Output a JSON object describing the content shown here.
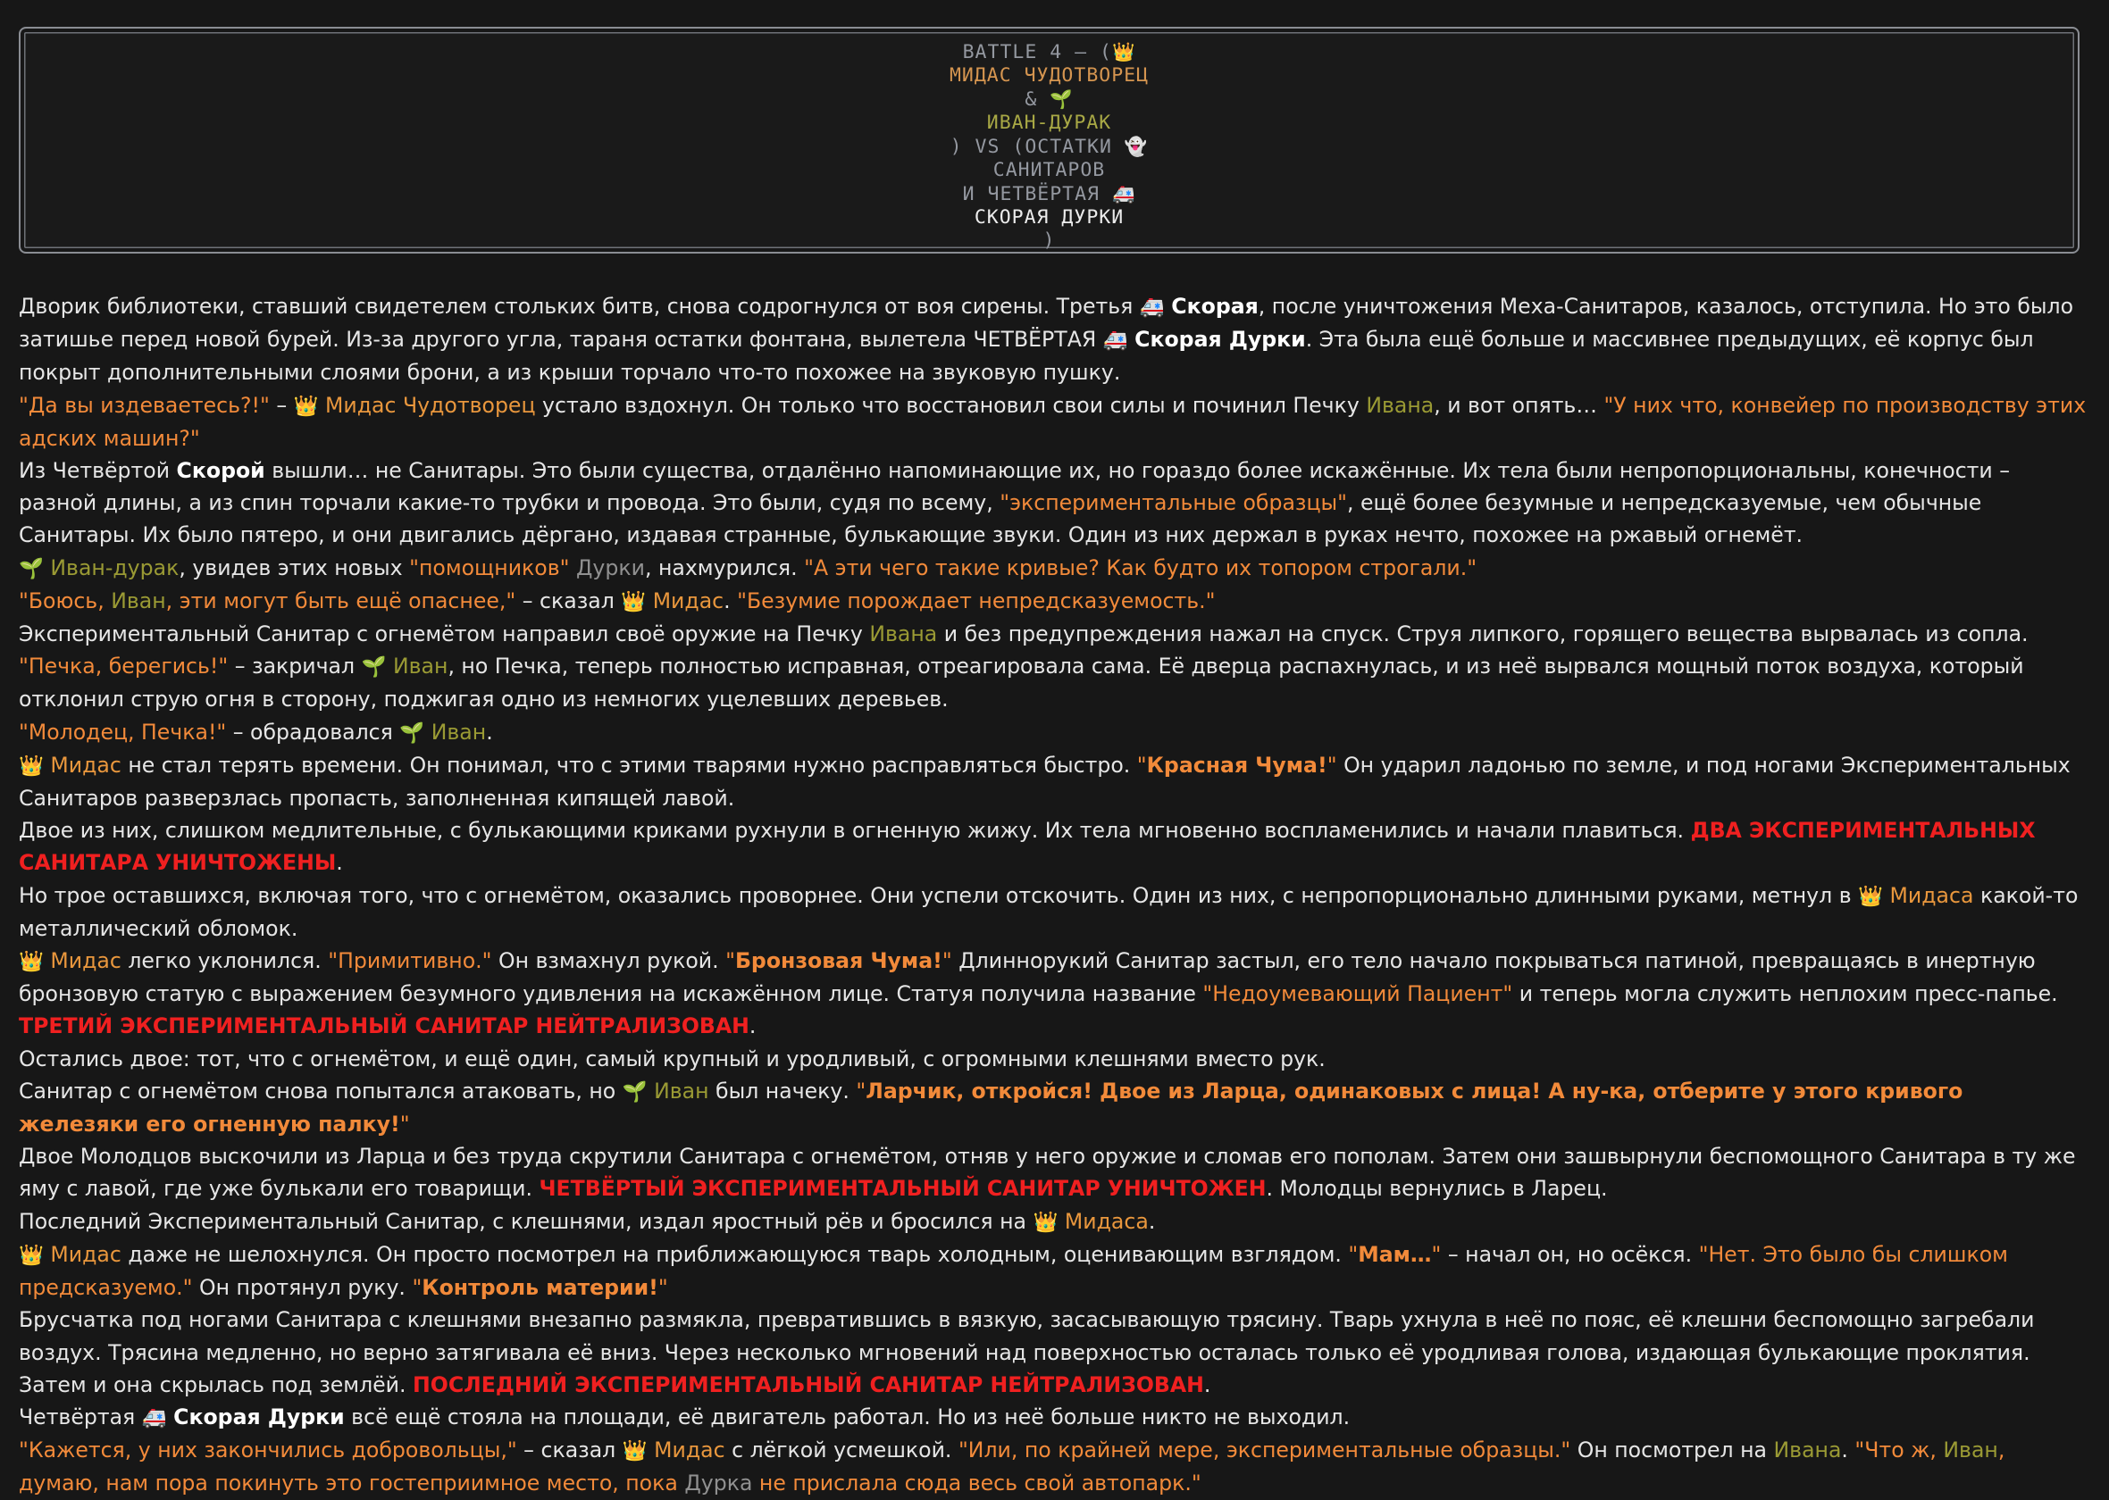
{
  "banner": {
    "l1": "BATTLE 4 – (",
    "l1_icon": "👑",
    "l2": "МИДАС ЧУДОТВОРЕЦ",
    "l3": "&",
    "l3_icon": "🌱",
    "l4": "ИВАН-ДУРАК",
    "l5": ") VS (ОСТАТКИ",
    "l5_icon": "👻",
    "l6": "САНИТАРОВ",
    "l7": "И ЧЕТВЁРТАЯ",
    "l7_icon": "🚑",
    "l8": "СКОРАЯ ДУРКИ",
    "l9": ")"
  },
  "icons": {
    "crown": "👑",
    "sprout": "🌱",
    "ambulance": "🚑"
  },
  "colors": {
    "background": "#171717",
    "quote": "#f28a3a",
    "ivan": "#9a9a34",
    "status": "#f02020",
    "durka": "#909090"
  },
  "story": {
    "p1": {
      "a": "Дворик библиотеки, ставший свидетелем стольких битв, снова содрогнулся от воя сирены. Третья ",
      "b": "Скорая",
      "c": ", после уничтожения Меха-Санитаров, казалось, отступила. Но это было затишье перед новой бурей. Из-за другого угла, тараня остатки фонтана, вылетела ЧЕТВЁРТАЯ ",
      "d": "Скорая Дурки",
      "e": ". Эта была ещё больше и массивнее предыдущих, её корпус был покрыт дополнительными слоями брони, а из крыши торчало что-то похожее на звуковую пушку."
    },
    "p2": {
      "a": "\"Да вы издеваетесь?!\"",
      "b": " – ",
      "c": "Мидас Чудотворец",
      "d": " устало вздохнул. Он только что восстановил свои силы и починил Печку ",
      "e": "Ивана",
      "f": ", и вот опять… ",
      "g": "\"У них что, конвейер по производству этих адских машин?\""
    },
    "p3": {
      "a": "Из Четвёртой ",
      "b": "Скорой",
      "c": " вышли… не Санитары. Это были существа, отдалённо напоминающие их, но гораздо более искажённые. Их тела были непропорциональны, конечности – разной длины, а из спин торчали какие-то трубки и провода. Это были, судя по всему, ",
      "d": "\"экспериментальные образцы\"",
      "e": ", ещё более безумные и непредсказуемые, чем обычные Санитары. Их было пятеро, и они двигались дёргано, издавая странные, булькающие звуки. Один из них держал в руках нечто, похожее на ржавый огнемёт."
    },
    "p4": {
      "a": "Иван-дурак",
      "b": ", увидев этих новых ",
      "c": "\"помощников\"",
      "d": " Дурки",
      "e": ", нахмурился. ",
      "f": "\"А эти чего такие кривые? Как будто их топором строгали.\""
    },
    "p5": {
      "a": "\"Боюсь, ",
      "b": "Иван",
      "c": ", эти могут быть ещё опаснее,\"",
      "d": " – сказал ",
      "e": "Мидас",
      "f": ". ",
      "g": "\"Безумие порождает непредсказуемость.\""
    },
    "p6": {
      "a": "Экспериментальный Санитар с огнемётом направил своё оружие на Печку ",
      "b": "Ивана",
      "c": " и без предупреждения нажал на спуск. Струя липкого, горящего вещества вырвалась из сопла."
    },
    "p7": {
      "a": "\"Печка, берегись!\"",
      "b": " – закричал ",
      "c": "Иван",
      "d": ", но Печка, теперь полностью исправная, отреагировала сама. Её дверца распахнулась, и из неё вырвался мощный поток воздуха, который отклонил струю огня в сторону, поджигая одно из немногих уцелевших деревьев."
    },
    "p8": {
      "a": "\"Молодец, Печка!\"",
      "b": " – обрадовался ",
      "c": "Иван",
      "d": "."
    },
    "p9": {
      "a": "Мидас",
      "b": " не стал терять времени. Он понимал, что с этими тварями нужно расправляться быстро. ",
      "c": "\"",
      "d": "Красная Чума!",
      "e": "\"",
      "f": " Он ударил ладонью по земле, и под ногами Экспериментальных Санитаров разверзлась пропасть, заполненная кипящей лавой."
    },
    "p10": {
      "a": "Двое из них, слишком медлительные, с булькающими криками рухнули в огненную жижу. Их тела мгновенно воспламенились и начали плавиться. ",
      "b": "ДВА ЭКСПЕРИМЕНТАЛЬНЫХ САНИТАРА УНИЧТОЖЕНЫ",
      "c": "."
    },
    "p11": {
      "a": "Но трое оставшихся, включая того, что с огнемётом, оказались проворнее. Они успели отскочить. Один из них, с непропорционально длинными руками, метнул в ",
      "b": "Мидаса",
      "c": " какой-то металлический обломок."
    },
    "p12": {
      "a": "Мидас",
      "b": " легко уклонился. ",
      "c": "\"Примитивно.\"",
      "d": " Он взмахнул рукой. ",
      "e": "\"",
      "f": "Бронзовая Чума!",
      "g": "\"",
      "h": " Длиннорукий Санитар застыл, его тело начало покрываться патиной, превращаясь в инертную бронзовую статую с выражением безумного удивления на искажённом лице. Статуя получила название ",
      "i": "\"Недоумевающий Пациент\"",
      "j": " и теперь могла служить неплохим пресс-папье. ",
      "k": "ТРЕТИЙ ЭКСПЕРИМЕНТАЛЬНЫЙ САНИТАР НЕЙТРАЛИЗОВАН",
      "l": "."
    },
    "p13": {
      "a": "Остались двое: тот, что с огнемётом, и ещё один, самый крупный и уродливый, с огромными клешнями вместо рук."
    },
    "p14": {
      "a": "Санитар с огнемётом снова попытался атаковать, но ",
      "b": "Иван",
      "c": " был начеку. ",
      "d": "\"",
      "e": "Ларчик, откройся! Двое из Ларца, одинаковых с лица! А ну-ка, отберите у этого кривого железяки его огненную палку!",
      "f": "\""
    },
    "p15": {
      "a": "Двое Молодцов выскочили из Ларца и без труда скрутили Санитара с огнемётом, отняв у него оружие и сломав его пополам. Затем они зашвырнули беспомощного Санитара в ту же яму с лавой, где уже булькали его товарищи. ",
      "b": "ЧЕТВЁРТЫЙ ЭКСПЕРИМЕНТАЛЬНЫЙ САНИТАР УНИЧТОЖЕН",
      "c": ". Молодцы вернулись в Ларец."
    },
    "p16": {
      "a": "Последний Экспериментальный Санитар, с клешнями, издал яростный рёв и бросился на ",
      "b": "Мидаса",
      "c": "."
    },
    "p17": {
      "a": "Мидас",
      "b": " даже не шелохнулся. Он просто посмотрел на приближающуюся тварь холодным, оценивающим взглядом. ",
      "c": "\"",
      "d": "Мам…",
      "e": "\"",
      "f": " – начал он, но осёкся. ",
      "g": "\"Нет. Это было бы слишком предсказуемо.\"",
      "h": " Он протянул руку. ",
      "i": "\"",
      "j": "Контроль материи!",
      "k": "\""
    },
    "p18": {
      "a": "Брусчатка под ногами Санитара с клешнями внезапно размякла, превратившись в вязкую, засасывающую трясину. Тварь ухнула в неё по пояс, её клешни беспомощно загребали воздух. Трясина медленно, но верно затягивала её вниз. Через несколько мгновений над поверхностью осталась только её уродливая голова, издающая булькающие проклятия. Затем и она скрылась под землёй. ",
      "b": "ПОСЛЕДНИЙ ЭКСПЕРИМЕНТАЛЬНЫЙ САНИТАР НЕЙТРАЛИЗОВАН",
      "c": "."
    },
    "p19": {
      "a": "Четвёртая ",
      "b": "Скорая Дурки",
      "c": " всё ещё стояла на площади, её двигатель работал. Но из неё больше никто не выходил."
    },
    "p20": {
      "a": "\"Кажется, у них закончились добровольцы,\"",
      "b": " – сказал ",
      "c": "Мидас",
      "d": " с лёгкой усмешкой. ",
      "e": "\"Или, по крайней мере, экспериментальные образцы.\"",
      "f": " Он посмотрел на ",
      "g": "Ивана",
      "h": ". ",
      "i": "\"Что ж, ",
      "j": "Иван",
      "k": ", думаю, нам пора покинуть это гостеприимное место, пока ",
      "l": "Дурка",
      "m": " не прислала сюда весь свой автопарк.\""
    }
  }
}
